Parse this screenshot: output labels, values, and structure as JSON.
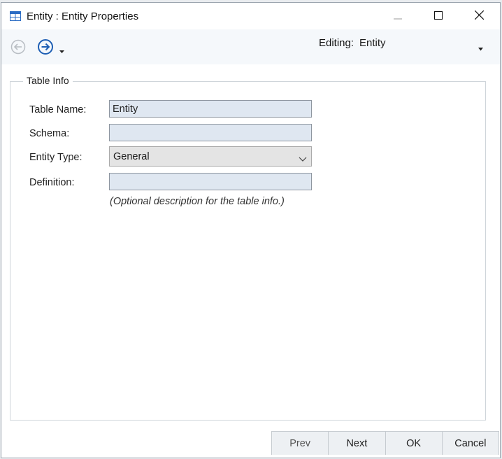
{
  "window": {
    "title": "Entity : Entity Properties"
  },
  "toolbar": {
    "back_icon": "arrow-left-circle-icon",
    "forward_icon": "arrow-right-circle-icon",
    "editing_label": "Editing:",
    "editing_value": "Entity"
  },
  "group": {
    "label": "Table Info"
  },
  "form": {
    "table_name_label": "Table Name:",
    "table_name_value": "Entity",
    "schema_label": "Schema:",
    "schema_value": "",
    "entity_type_label": "Entity Type:",
    "entity_type_value": "General",
    "definition_label": "Definition:",
    "definition_value": "",
    "definition_hint": "(Optional description for the table info.)"
  },
  "buttons": {
    "prev": "Prev",
    "next": "Next",
    "ok": "OK",
    "cancel": "Cancel"
  },
  "colors": {
    "accent": "#1e5fb4",
    "input_bg": "#dfe7f1",
    "toolbar_bg": "#f5f8fb"
  }
}
